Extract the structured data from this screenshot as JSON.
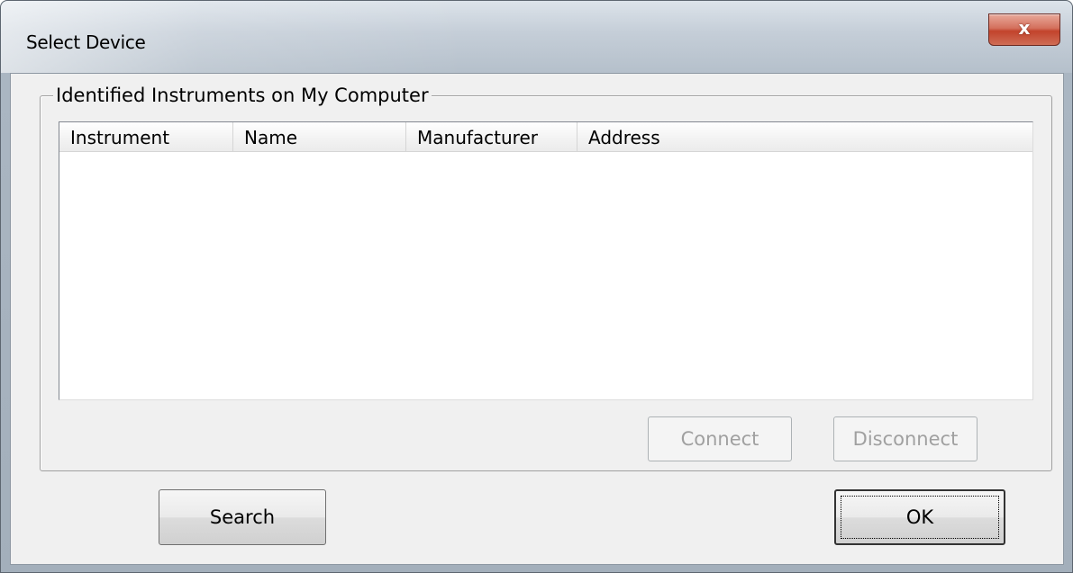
{
  "window": {
    "title": "Select Device",
    "close_glyph": "x"
  },
  "group": {
    "label": "Identified Instruments on My Computer"
  },
  "table": {
    "columns": [
      "Instrument",
      "Name",
      "Manufacturer",
      "Address"
    ],
    "rows": []
  },
  "buttons": {
    "connect": "Connect",
    "disconnect": "Disconnect",
    "search": "Search",
    "ok": "OK"
  },
  "colors": {
    "close_button": "#c2432c",
    "dialog_background": "#f0f0f0",
    "disabled_text": "#a0a0a0"
  }
}
